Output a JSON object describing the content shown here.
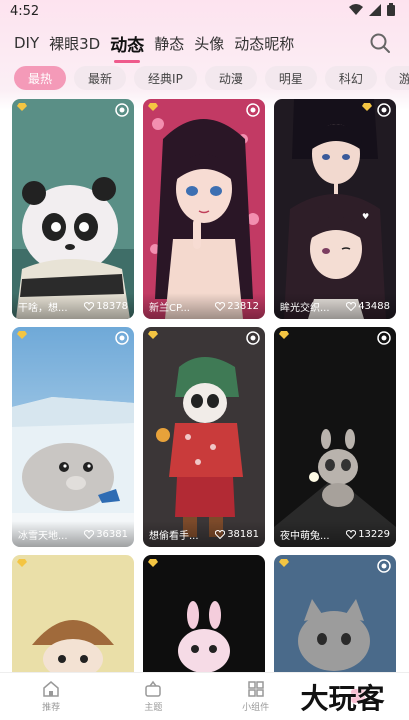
{
  "status": {
    "time": "4:52"
  },
  "tabs": [
    {
      "label": "DIY"
    },
    {
      "label": "裸眼3D"
    },
    {
      "label": "动态"
    },
    {
      "label": "静态"
    },
    {
      "label": "头像"
    },
    {
      "label": "动态昵称"
    }
  ],
  "active_tab": "动态",
  "chips": [
    {
      "label": "最热"
    },
    {
      "label": "最新"
    },
    {
      "label": "经典IP"
    },
    {
      "label": "动漫"
    },
    {
      "label": "明星"
    },
    {
      "label": "科幻"
    },
    {
      "label": "游戏"
    }
  ],
  "active_chip": "最热",
  "cards": [
    {
      "title": "干啥，想...",
      "likes": "18378",
      "scene": "panda"
    },
    {
      "title": "新兰CP...",
      "likes": "23812",
      "scene": "anime-girl"
    },
    {
      "title": "眸光交织...",
      "likes": "43488",
      "scene": "anime-couple"
    },
    {
      "title": "冰雪天地...",
      "likes": "36381",
      "scene": "seal"
    },
    {
      "title": "想偷看手...",
      "likes": "38181",
      "scene": "panda-girl"
    },
    {
      "title": "夜中萌兔...",
      "likes": "13229",
      "scene": "night-bunny"
    },
    {
      "title": "",
      "likes": "",
      "scene": "baby-hat"
    },
    {
      "title": "",
      "likes": "",
      "scene": "pink-bunny"
    },
    {
      "title": "",
      "likes": "",
      "scene": "cat"
    }
  ],
  "bottom_nav": [
    {
      "label": "推荐",
      "icon": "home-icon"
    },
    {
      "label": "主题",
      "icon": "theme-icon"
    },
    {
      "label": "小组件",
      "icon": "widgets-icon"
    },
    {
      "label": "",
      "icon": "wallpaper-icon"
    }
  ],
  "watermark": {
    "text": "大玩客"
  },
  "colors": {
    "accent": "#ef5a8c",
    "chip_active": "#f49ab8"
  }
}
